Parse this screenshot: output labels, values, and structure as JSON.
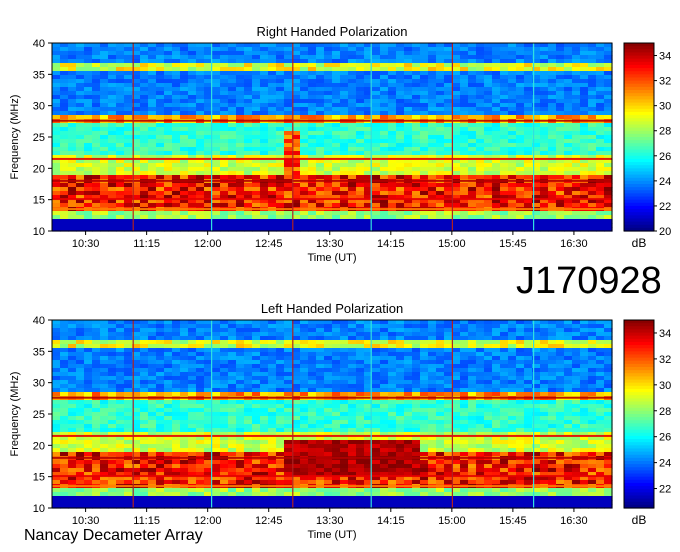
{
  "observation_id": "J170928",
  "footer": "Nancay Decameter Array",
  "chart_data": [
    {
      "type": "heatmap",
      "title": "Right Handed Polarization",
      "xlabel": "Time (UT)",
      "ylabel": "Frequency (MHz)",
      "x_ticks": [
        "10:30",
        "11:15",
        "12:00",
        "12:45",
        "13:30",
        "14:15",
        "15:00",
        "15:45",
        "16:30"
      ],
      "y_ticks": [
        10,
        15,
        20,
        25,
        30,
        35,
        40
      ],
      "ylim": [
        10,
        40
      ],
      "colorbar": {
        "label": "dB",
        "ticks": [
          20,
          22,
          24,
          26,
          28,
          30,
          32,
          34
        ],
        "range": [
          20,
          35
        ]
      }
    },
    {
      "type": "heatmap",
      "title": "Left Handed Polarization",
      "xlabel": "Time (UT)",
      "ylabel": "Frequency (MHz)",
      "x_ticks": [
        "10:30",
        "11:15",
        "12:00",
        "12:45",
        "13:30",
        "14:15",
        "15:00",
        "15:45",
        "16:30"
      ],
      "y_ticks": [
        10,
        15,
        20,
        25,
        30,
        35,
        40
      ],
      "ylim": [
        10,
        40
      ],
      "colorbar": {
        "label": "dB",
        "ticks": [
          22,
          24,
          26,
          28,
          30,
          32,
          34
        ],
        "range": [
          20.5,
          35
        ]
      }
    }
  ]
}
